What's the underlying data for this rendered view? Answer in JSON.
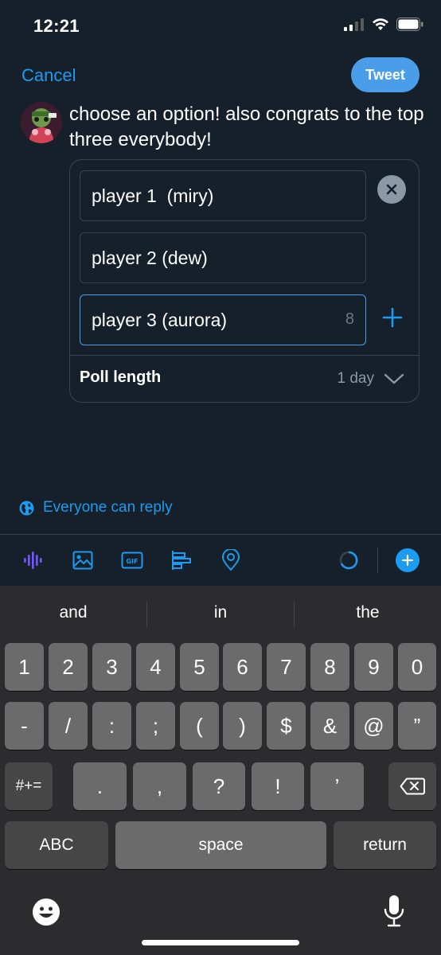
{
  "status": {
    "time": "12:21",
    "icons": [
      "signal-icon",
      "wifi-icon",
      "battery-icon"
    ]
  },
  "header": {
    "cancel_label": "Cancel",
    "tweet_label": "Tweet"
  },
  "compose": {
    "text": "choose an option! also congrats to the top three everybody!"
  },
  "poll": {
    "options": [
      {
        "value": "player 1  (miry)"
      },
      {
        "value": "player 2 (dew)"
      },
      {
        "value": "player 3 (aurora)",
        "remaining_chars": "8"
      }
    ],
    "length_label": "Poll length",
    "length_value": "1 day"
  },
  "reply_setting": {
    "label": "Everyone can reply"
  },
  "toolbar": {
    "icons": [
      "voice-icon",
      "image-icon",
      "gif-icon",
      "poll-icon",
      "location-icon"
    ],
    "gif_label": "GIF"
  },
  "keyboard": {
    "suggestions": [
      "and",
      "in",
      "the"
    ],
    "row1": [
      "1",
      "2",
      "3",
      "4",
      "5",
      "6",
      "7",
      "8",
      "9",
      "0"
    ],
    "row2": [
      "-",
      "/",
      ":",
      ";",
      "(",
      ")",
      "$",
      "&",
      "@",
      "”"
    ],
    "row3_left": "#+=",
    "row3": [
      ".",
      ",",
      "?",
      "!",
      "’"
    ],
    "abc_label": "ABC",
    "space_label": "space",
    "return_label": "return"
  },
  "colors": {
    "background": "#15202b",
    "accent": "#1d9bf0",
    "border": "#38444d",
    "keyboard": "#2c2c2e"
  }
}
